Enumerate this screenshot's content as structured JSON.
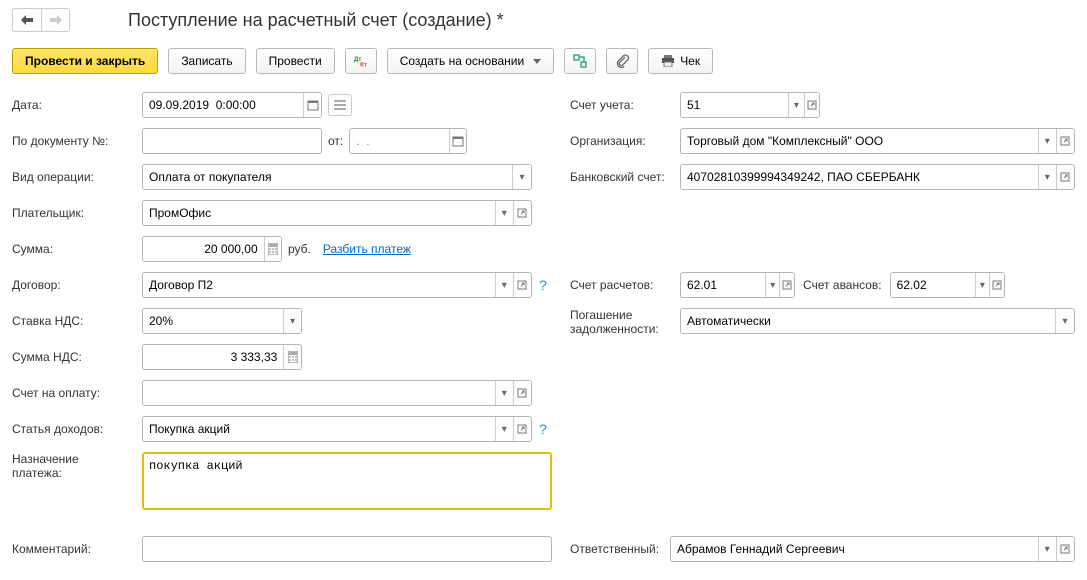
{
  "title": "Поступление на расчетный счет (создание) *",
  "toolbar": {
    "post_close": "Провести и закрыть",
    "save": "Записать",
    "post": "Провести",
    "create_based": "Создать на основании",
    "cheque": "Чек"
  },
  "labels": {
    "date": "Дата:",
    "by_doc_no": "По документу №:",
    "ot": "от:",
    "operation_type": "Вид операции:",
    "payer": "Плательщик:",
    "sum": "Сумма:",
    "rub": "руб.",
    "split_payment": "Разбить платеж",
    "contract": "Договор:",
    "vat_rate": "Ставка НДС:",
    "vat_sum": "Сумма НДС:",
    "invoice": "Счет на оплату:",
    "income_item": "Статья доходов:",
    "purpose": "Назначение",
    "purpose2": "платежа:",
    "comment": "Комментарий:",
    "account": "Счет учета:",
    "organization": "Организация:",
    "bank_account": "Банковский счет:",
    "settle_account": "Счет расчетов:",
    "advance_account": "Счет авансов:",
    "debt_repayment": "Погашение",
    "debt_repayment2": "задолженности:",
    "responsible": "Ответственный:"
  },
  "values": {
    "date": "09.09.2019  0:00:00",
    "doc_no": "",
    "doc_date": ".  .",
    "operation_type": "Оплата от покупателя",
    "payer": "ПромОфис",
    "sum": "20 000,00",
    "contract": "Договор П2",
    "vat_rate": "20%",
    "vat_sum": "3 333,33",
    "invoice": "",
    "income_item": "Покупка акций",
    "purpose": "покупка акций",
    "comment": "",
    "account": "51",
    "organization": "Торговый дом \"Комплексный\" ООО",
    "bank_account": "40702810399994349242, ПАО СБЕРБАНК",
    "settle_account": "62.01",
    "advance_account": "62.02",
    "debt_repayment": "Автоматически",
    "responsible": "Абрамов Геннадий Сергеевич"
  }
}
